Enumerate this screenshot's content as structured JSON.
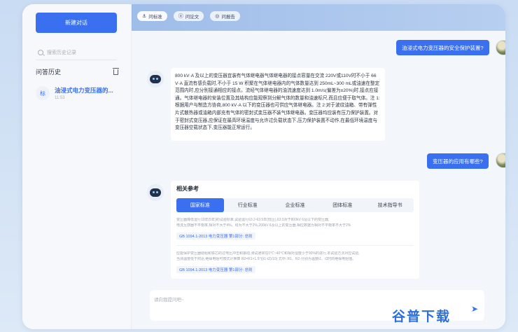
{
  "sidebar": {
    "new_chat_label": "新建对话",
    "search_placeholder": "搜索历史记录",
    "history_title": "问答历史",
    "history_items": [
      {
        "badge": "标",
        "title": "油浸式电力变压器的...",
        "time": "11:53"
      }
    ]
  },
  "topbar": {
    "tabs": [
      {
        "icon": "anchor-icon",
        "label": "问标准"
      },
      {
        "icon": "a-icon",
        "label": "问论文"
      },
      {
        "icon": "report-icon",
        "label": "问报告"
      }
    ]
  },
  "chat": {
    "q1": "油浸式电力变压器的安全保护装置?",
    "a1": "800 kV·A 及以上的变压器宜装有气体继电器气体继电器的接点容量在交流 220V或110V时不小于 66 V·A 直流有感负载时,不小于 15 W 积聚在气体继电器内的气体数量达到 250mL~300 mL或油速在整定范围内时,应分别接通相应的接点。流经气体继电器的油流速度达到 1.0m/s(偏差为±20%)时,接点应接通。气体继电器的安装位置及其结构应能观察到分解气体的数量和油速标尺,而且应便于取气体。注 1:根据用户与制造方协商,800 kV·A 以下的变压器也可供应气体继电器。注 2:对于波纹油箱、带有弹性片式散热器或油箱内部充有气体的密封式变压器不装气体继电器。变压器均应装有压力保护装置。对于密封式变压器,应保证在最高环境温度与允许过负载状态下,压力保护装置不动作,在最低环境温度与变压器空载状态下,变压器能正常运行。",
    "q2": "变压器的应用有哪些?"
  },
  "references": {
    "title": "相关参考",
    "tabs": [
      "国家标准",
      "行业标准",
      "企业标准",
      "团体标准",
      "技术指导书"
    ],
    "items": [
      {
        "line1": "变压器降低运行10年(5年)的试验标准,试验运行63.2-63.5年(低压),63.5对于800kV 6及以下的变压器,",
        "line2": "电流互感器不平衡率,相对不大于4%。线为不大于2%,200kV 6及以上的变压器,相应数据为相对不平衡率不大于2%",
        "link": "GB 1094.1-2013 电力变压器 第1部分: 总则"
      },
      {
        "line1": "应能保护变压器绕组和铁芯的过电压冲击和振动,测试通常在0℃~40℃和相对湿度小于90%的进行,本试验方法对应试验,",
        "line2": "当测温度低于附近,绝缘电阻可按式计换算 R2=R1×1.5^((t1-t2)/10) 式中: R1、R2-分别为温度t1、t2时的绝缘电阻值。",
        "link": "GB 1094.1-2013 电力变压器 第1部分: 总则"
      }
    ]
  },
  "input": {
    "placeholder": "请向我提问吧~"
  },
  "watermark": "谷普下载",
  "colors": {
    "accent": "#3a6ff0",
    "topbar": "#a9c5ec"
  }
}
